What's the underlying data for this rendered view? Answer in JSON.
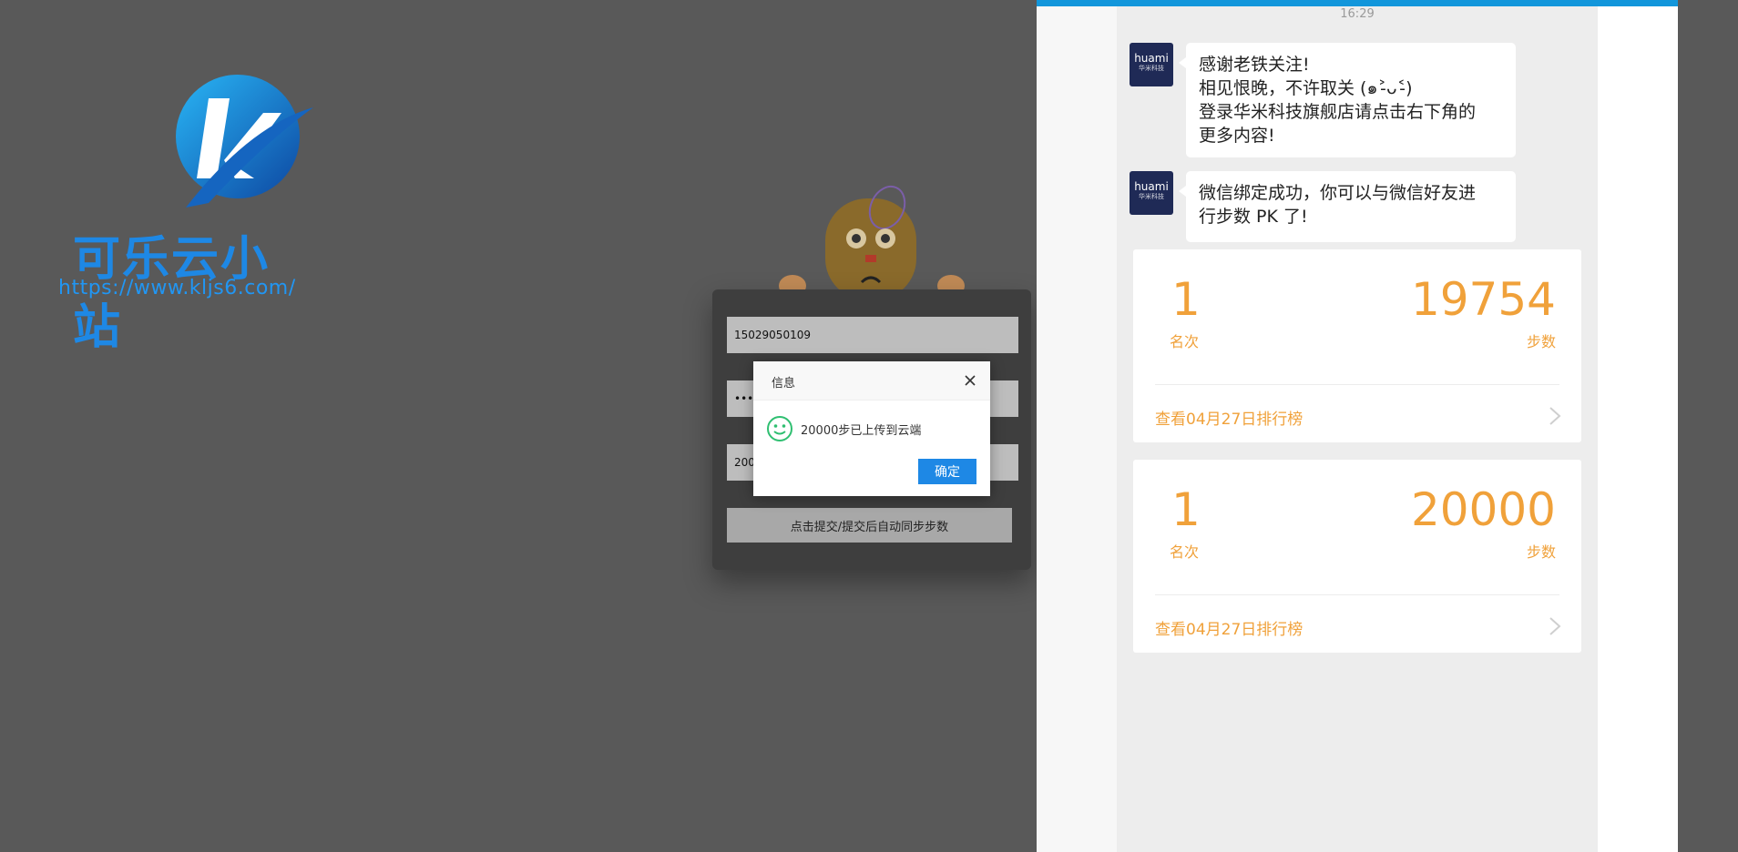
{
  "logo": {
    "name": "可乐云小站",
    "url": "https://www.kljs6.com/",
    "icon": "logo-k-circle-icon"
  },
  "form": {
    "phone_value": "15029050109",
    "password_value": "•••••",
    "steps_value": "20000",
    "submit_label": "点击提交/提交后自动同步步数"
  },
  "dialog": {
    "title": "信息",
    "message": "20000步已上传到云端",
    "ok_label": "确定"
  },
  "phone": {
    "time": "16:29",
    "avatar": {
      "line1": "huami",
      "line2": "华米科技"
    },
    "messages": [
      {
        "lines": [
          "感谢老铁关注!",
          "相见恨晚，不许取关 (๑˃̵ᴗ˂̵)",
          "登录华米科技旗舰店请点击右下角的",
          "更多内容!"
        ]
      },
      {
        "lines": [
          "微信绑定成功，你可以与微信好友进",
          "行步数 PK 了!"
        ]
      }
    ],
    "cards": [
      {
        "rank": "1",
        "rank_label": "名次",
        "steps": "19754",
        "steps_label": "步数",
        "link": "查看04月27日排行榜"
      },
      {
        "rank": "1",
        "rank_label": "名次",
        "steps": "20000",
        "steps_label": "步数",
        "link": "查看04月27日排行榜"
      }
    ]
  },
  "colors": {
    "background": "#595959",
    "accent_blue": "#1e88e5",
    "orange": "#f0a13a",
    "success_green": "#2fbf71"
  }
}
